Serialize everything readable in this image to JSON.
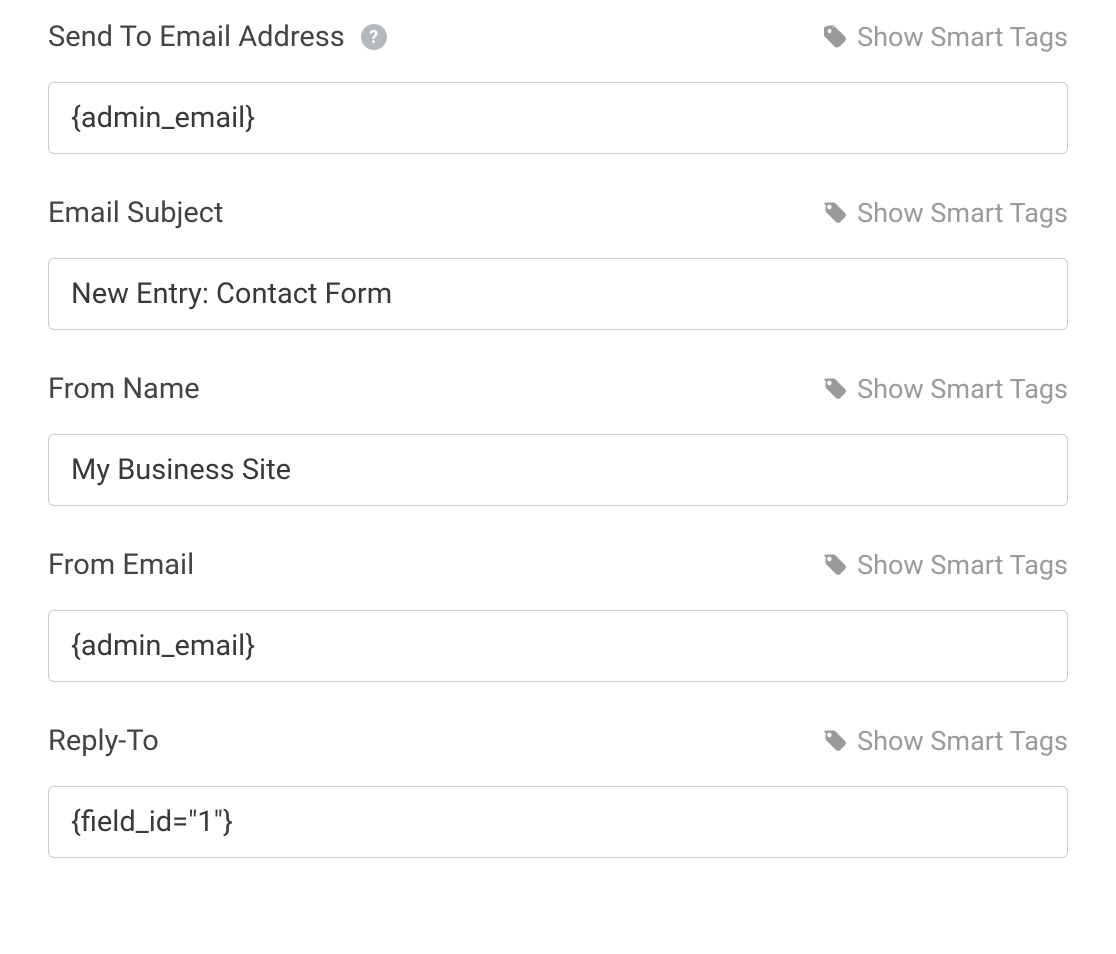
{
  "smart_tags_label": "Show Smart Tags",
  "fields": {
    "send_to": {
      "label": "Send To Email Address",
      "value": "{admin_email}",
      "has_help": true
    },
    "email_subject": {
      "label": "Email Subject",
      "value": "New Entry: Contact Form",
      "has_help": false
    },
    "from_name": {
      "label": "From Name",
      "value": "My Business Site",
      "has_help": false
    },
    "from_email": {
      "label": "From Email",
      "value": "{admin_email}",
      "has_help": false
    },
    "reply_to": {
      "label": "Reply-To",
      "value": "{field_id=\"1\"}",
      "has_help": false
    }
  }
}
